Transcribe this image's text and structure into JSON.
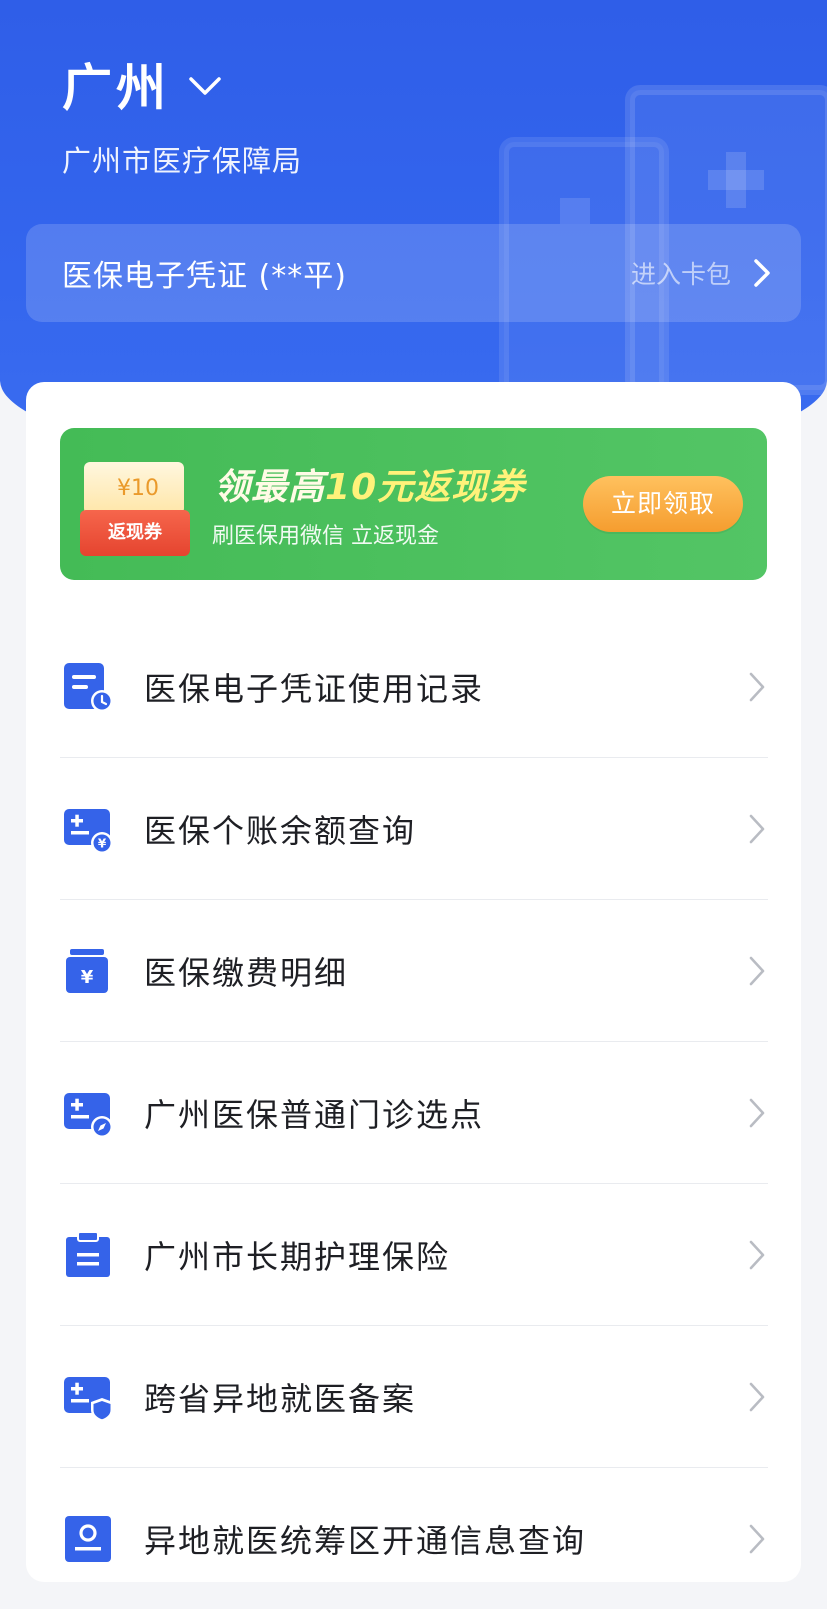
{
  "header": {
    "city": "广州",
    "bureau": "广州市医疗保障局",
    "card_title": "医保电子凭证 (**平)",
    "card_link": "进入卡包"
  },
  "banner": {
    "coupon_amount": "¥10",
    "coupon_tag": "返现券",
    "title_prefix": "领最高",
    "title_highlight": "10元返现券",
    "subtitle": "刷医保用微信 立返现金",
    "button": "立即领取"
  },
  "menu": {
    "items": [
      {
        "label": "医保电子凭证使用记录",
        "icon": "record-clock-icon"
      },
      {
        "label": "医保个账余额查询",
        "icon": "balance-yen-icon"
      },
      {
        "label": "医保缴费明细",
        "icon": "payment-detail-icon"
      },
      {
        "label": "广州医保普通门诊选点",
        "icon": "clinic-location-icon"
      },
      {
        "label": "广州市长期护理保险",
        "icon": "clipboard-icon"
      },
      {
        "label": "跨省异地就医备案",
        "icon": "shield-card-icon"
      },
      {
        "label": "异地就医统筹区开通信息查询",
        "icon": "user-card-icon"
      }
    ]
  },
  "colors": {
    "primary": "#2f5ee8",
    "banner_green": "#4cbf5e",
    "button_orange": "#f7a83b",
    "icon_blue": "#3563e9"
  }
}
